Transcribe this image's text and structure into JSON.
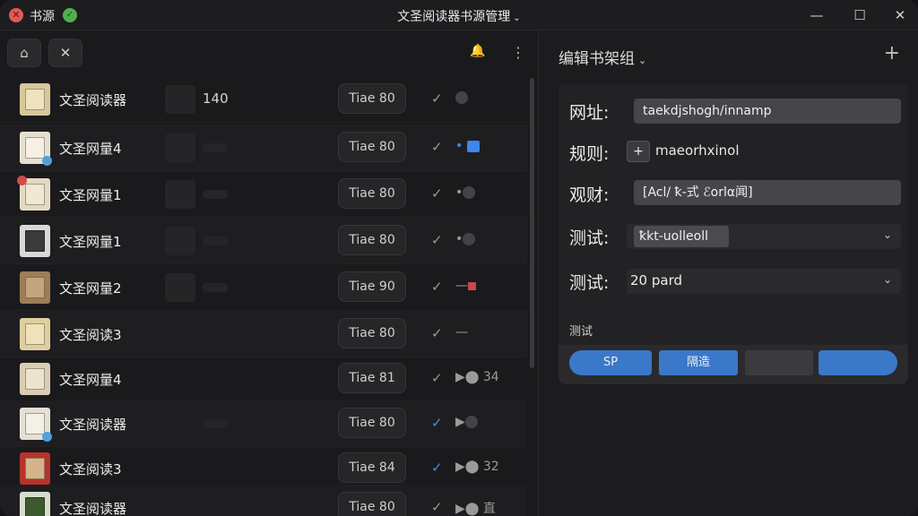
{
  "titlebar": {
    "app_name": "书源",
    "title": "文圣阅读器书源管理",
    "title_chevron": "⌄",
    "minimize_glyph": "—",
    "maximize_glyph": "☐",
    "close_glyph": "✕"
  },
  "left_toolbar": {
    "home_glyph": "⌂",
    "close_glyph": "✕",
    "bell_glyph": "🔔",
    "more_glyph": "⋮"
  },
  "books": [
    {
      "name": "文圣阅读器",
      "count": "140",
      "tag": "Tiae 80",
      "edit": "✓",
      "cover_color": "#d8c79a",
      "badge": ""
    },
    {
      "name": "文圣网量4",
      "count": "",
      "tag": "Tiae 80",
      "edit": "✓",
      "cover_color": "#e6e0cf",
      "badge": "#4fa0e0"
    },
    {
      "name": "文圣网量1",
      "count": "",
      "tag": "Tiae 80",
      "edit": "✓",
      "cover_color": "#e4dac2",
      "badge": "#d24a46"
    },
    {
      "name": "文圣网量1",
      "count": "",
      "tag": "Tiae 80",
      "edit": "✓",
      "cover_color": "#d8d8d8",
      "badge": ""
    },
    {
      "name": "文圣网量2",
      "count": "",
      "tag": "Tiae 90",
      "edit": "✓",
      "cover_color": "#9e7d58",
      "badge": ""
    },
    {
      "name": "文圣阅读3",
      "count": "",
      "tag": "Tiae 80",
      "edit": "✓",
      "cover_color": "#dfcf9e",
      "badge": ""
    },
    {
      "name": "文圣网量4",
      "count": "",
      "tag": "Tiae 81",
      "edit": "✓",
      "cover_color": "#d9ceb4",
      "badge": ""
    },
    {
      "name": "文圣阅读器",
      "count": "",
      "tag": "Tiae 80",
      "edit": "✓",
      "cover_color": "#e4e0d4",
      "badge": "#4fa0e0"
    },
    {
      "name": "文圣阅读3",
      "count": "",
      "tag": "Tiae 84",
      "edit": "✓",
      "cover_color": "#b8322c",
      "badge": ""
    },
    {
      "name": "文圣阅读器",
      "count": "",
      "tag": "Tiae 80",
      "edit": "✓",
      "cover_color": "#d6dccb",
      "badge": ""
    }
  ],
  "row_status": [
    "▶⬤ 34",
    "▶⬤ 32",
    "▶⬤ 直"
  ],
  "editor": {
    "title": "编辑书架组",
    "title_chevron": "⌄",
    "add_glyph": "+",
    "url_label": "网址:",
    "url_value": "taekdjshogh/innamp",
    "rule_label": "规则:",
    "rule_plus": "+",
    "rule_value": "maeorhxinol",
    "view_label": "观财:",
    "view_value": "[Acl/ ꝁ-式 ℰorlα闻]",
    "test1_label": "测试:",
    "test1_value": "ꝁkt-uolleoll",
    "test2_label": "测试:",
    "test2_value": "20 pard",
    "select_chevron": "⌄",
    "section_label": "测试",
    "btn_sp": "SP",
    "btn_filter": "隔造",
    "btn_blue": "#3a78c9",
    "btn_gray": "#3b3b3f"
  }
}
